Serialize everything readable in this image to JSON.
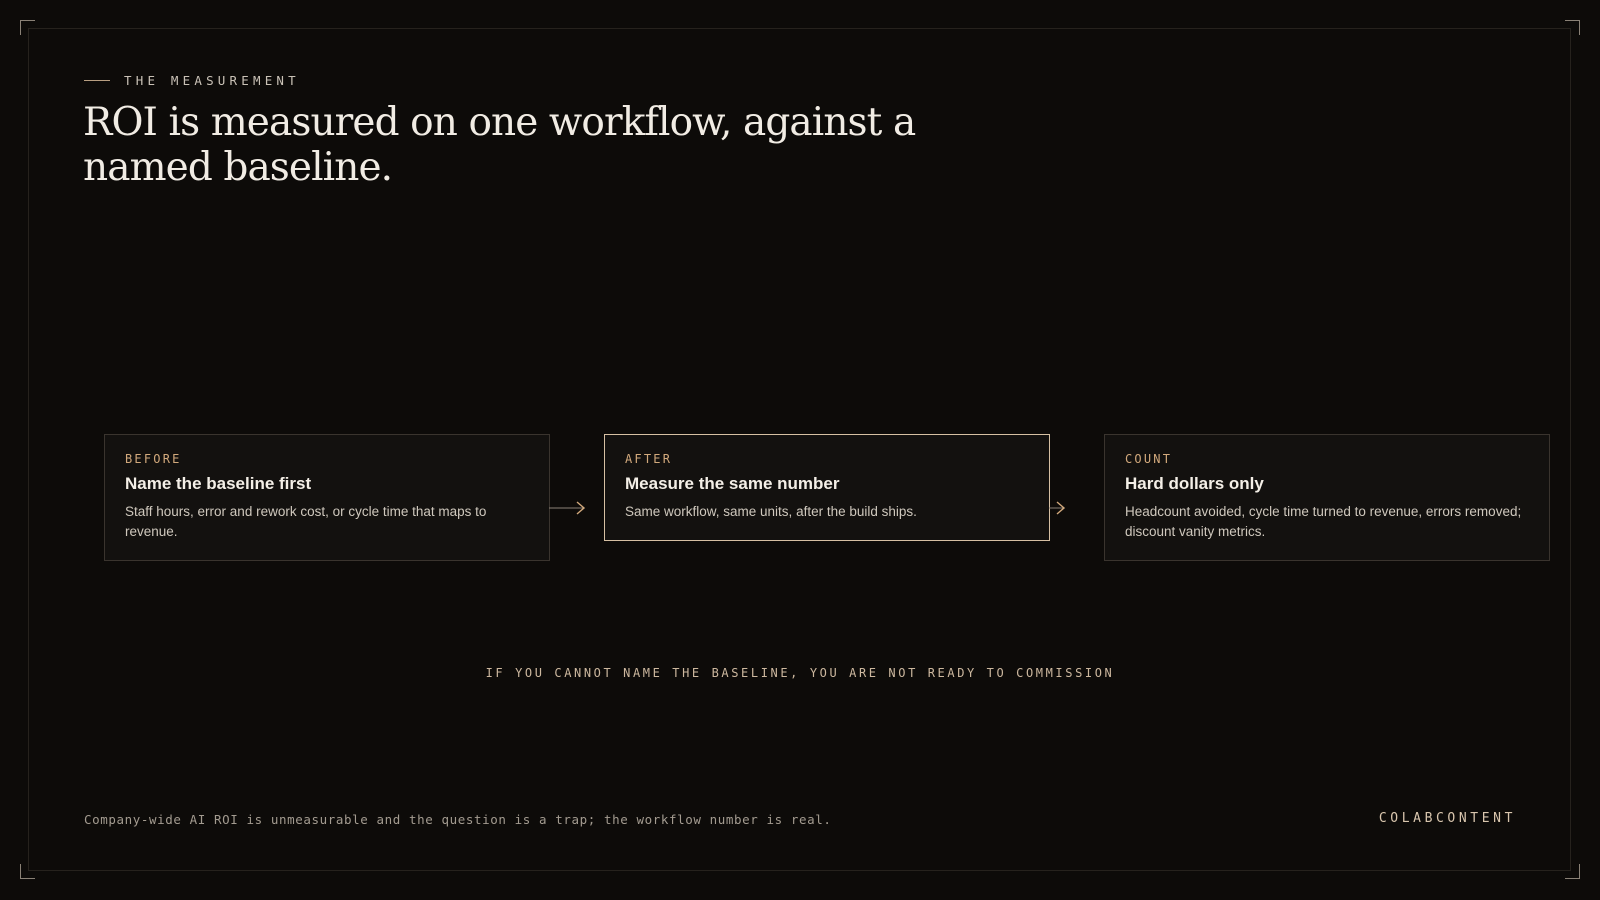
{
  "eyebrow": {
    "label": "THE MEASUREMENT"
  },
  "title": "ROI is measured on one workflow, against a named baseline.",
  "steps": [
    {
      "kicker": "BEFORE",
      "heading": "Name the baseline first",
      "body": "Staff hours, error and rework cost, or cycle time that maps to revenue.",
      "highlighted": false
    },
    {
      "kicker": "AFTER",
      "heading": "Measure the same number",
      "body": "Same workflow, same units, after the build ships.",
      "highlighted": true
    },
    {
      "kicker": "COUNT",
      "heading": "Hard dollars only",
      "body": "Headcount avoided, cycle time turned to revenue, errors removed; discount vanity metrics.",
      "highlighted": false
    }
  ],
  "callout": "IF YOU CANNOT NAME THE BASELINE, YOU ARE NOT READY TO COMMISSION",
  "footer": {
    "note": "Company-wide AI ROI is unmeasurable and the question is a trap; the workflow number is real.",
    "brand": "COLABCONTENT"
  },
  "colors": {
    "background": "#0d0b09",
    "accent": "#d2a97c",
    "highlight_border": "#d6c0a3",
    "card_border": "#3a342e"
  }
}
